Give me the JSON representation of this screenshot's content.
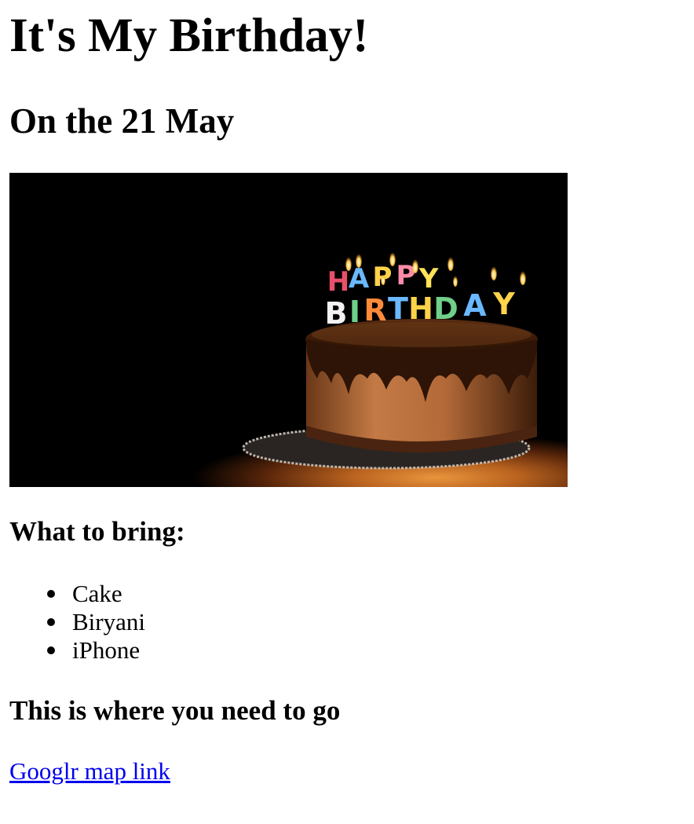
{
  "page": {
    "title": "It's My Birthday!",
    "date_heading": "On the 21 May"
  },
  "image": {
    "subject": "birthday-cake-photo",
    "candle_text": "HAPPY BIRTHDAY",
    "background_color": "#000000"
  },
  "bring": {
    "heading": "What to bring:",
    "items": [
      "Cake",
      "Biryani",
      "iPhone"
    ]
  },
  "location": {
    "heading": "This is where you need to go",
    "link_text": "Googlr map link",
    "link_color": "#0000ee"
  }
}
